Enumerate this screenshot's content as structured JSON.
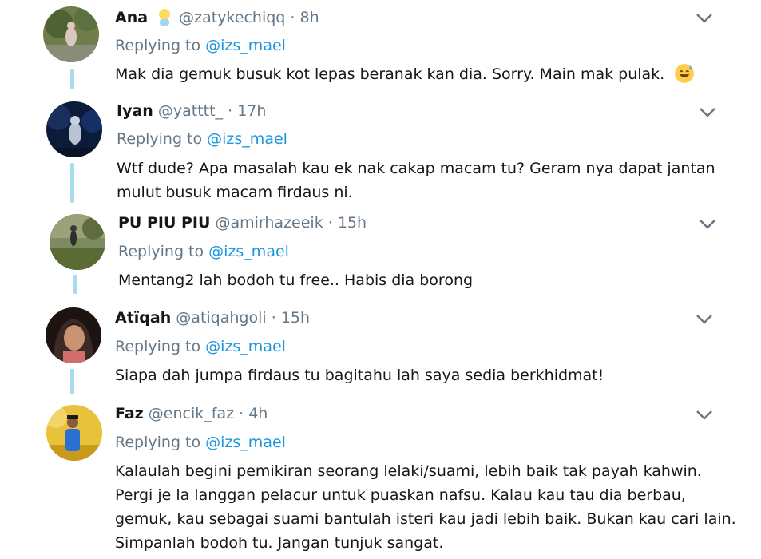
{
  "tweets": [
    {
      "name": "Ana",
      "handle": "@zatykechiqq",
      "dot": "·",
      "time": "8h",
      "replying_prefix": "Replying to ",
      "replying_to": "@izs_mael",
      "text_lines": [
        "Mak dia gemuk busuk kot lepas beranak kan dia. Sorry. Main mak pulak."
      ],
      "name_emoji": "person-emoji",
      "text_emoji": "grinning-sweat-emoji"
    },
    {
      "name": "Iyan",
      "handle": "@yatttt_",
      "dot": "·",
      "time": "17h",
      "replying_prefix": "Replying to ",
      "replying_to": "@izs_mael",
      "text_lines": [
        "Wtf dude? Apa masalah kau ek nak cakap macam tu? Geram nya dapat jantan",
        "mulut busuk macam firdaus ni."
      ]
    },
    {
      "name": "PU PIU PIU",
      "handle": "@amirhazeeik",
      "dot": "·",
      "time": "15h",
      "replying_prefix": "Replying to ",
      "replying_to": "@izs_mael",
      "text_lines": [
        "Mentang2 lah bodoh tu free.. Habis dia borong"
      ]
    },
    {
      "name": "Atïqah",
      "handle": "@atiqahgoli",
      "dot": "·",
      "time": "15h",
      "replying_prefix": "Replying to ",
      "replying_to": "@izs_mael",
      "text_lines": [
        "Siapa dah jumpa firdaus tu bagitahu lah saya sedia berkhidmat!"
      ]
    },
    {
      "name": "Faz",
      "handle": "@encik_faz",
      "dot": "·",
      "time": "4h",
      "replying_prefix": "Replying to ",
      "replying_to": "@izs_mael",
      "text_lines": [
        "Kalaulah begini pemikiran seorang lelaki/suami, lebih baik tak payah kahwin.",
        "Pergi je la langgan pelacur untuk puaskan nafsu. Kalau kau tau dia berbau,",
        "gemuk, kau sebagai suami bantulah isteri kau jadi lebih baik. Bukan kau cari lain.",
        "Simpanlah bodoh tu. Jangan tunjuk sangat."
      ]
    }
  ],
  "colors": {
    "link": "#1b95e0",
    "muted": "#657786",
    "thread_line": "#a7dcea",
    "text": "#14171a"
  },
  "icons": {
    "more": "chevron-down-icon"
  }
}
